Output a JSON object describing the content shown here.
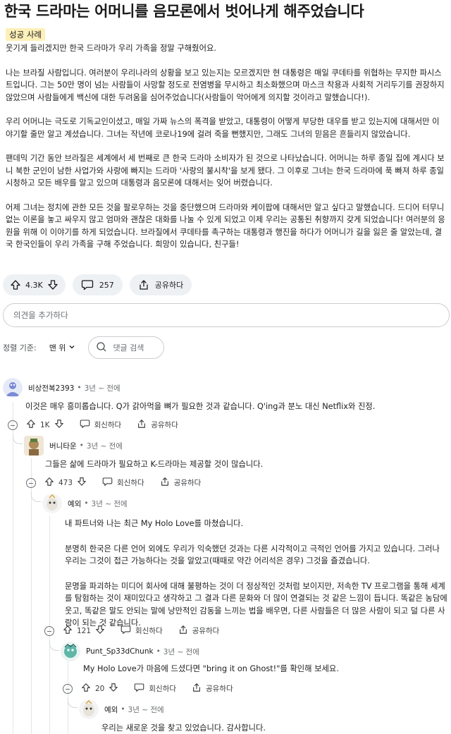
{
  "post": {
    "title": "한국 드라마는 어머니를 음모론에서 벗어나게 해주었습니다",
    "flair": "성공 사례",
    "paragraphs": [
      "웃기게 들리겠지만 한국 드라마가 우리 가족을 정말 구해줬어요.",
      "나는 브라질 사람입니다. 여러분이 우리나라의 상황을 보고 있는지는 모르겠지만 현 대통령은 매일 쿠데타를 위협하는 무지한 파시스트입니다. 그는 50만 명이 넘는 사람들이 사망할 정도로 전염병을 무시하고 최소화했으며 마스크 착용과 사회적 거리두기를 권장하지 않았으며 사람들에게 백신에 대한 두려움을 심어주었습니다(사람들이 악어에게 의지할 것이라고 말했습니다!).",
      "우리 어머니는 극도로 기독교인이셨고, 매일 가짜 뉴스의 폭격을 받았고, 대통령이 어떻게 부당한 대우를 받고 있는지에 대해서만 이야기할 줄만 알고 계셨습니다. 그녀는 작년에 코로나19에 걸려 죽을 뻔했지만, 그래도 그녀의 믿음은 흔들리지 않았습니다.",
      "팬데믹 기간 동안 브라질은 세계에서 세 번째로 큰 한국 드라마 소비자가 된 것으로 나타났습니다. 어머니는 하루 종일 집에 계시다 보니 북한 군인이 남한 사업가와 사랑에 빠지는 드라마 '사랑의 불시착'을 보게 됐다. 그 이후로 그녀는 한국 드라마에 푹 빠져 하루 종일 시청하고 모든 배우를 알고 있으며 대통령과 음모론에 대해서는 잊어 버렸습니다.",
      "어제 그녀는 정치에 관한 모든 것을 팔로우하는 것을 중단했으며 드라마와 케이팝에 대해서만 알고 싶다고 말했습니다. 드디어 터무니없는 이론을 놓고 싸우지 않고 엄마와 괜찮은 대화를 나눌 수 있게 되었고 이제 우리는 공통된 취향까지 갖게 되었습니다! 여러분의 응원을 위해 이 이야기를 하게 되었습니다. 브라질에서 쿠데타를 촉구하는 대통령과 행진을 하다가 어머니가 길을 잃은 줄 알았는데, 결국 한국인들이 우리 가족을 구해 주었습니다. 희망이 있습니다, 친구들!"
    ],
    "votes": "4.3K",
    "comment_count": "257",
    "share_label": "공유하다"
  },
  "comment_input": {
    "placeholder": "의견을 추가하다"
  },
  "sort": {
    "label": "정렬 기준:",
    "value": "맨 위",
    "search_placeholder": "댓글 검색"
  },
  "comments": [
    {
      "author": "비상전복2393",
      "time": "3년 ~ 전에",
      "paragraphs": [
        "이것은 매우 흥미롭습니다. Q가 갉아먹을 뼈가 필요한 것과 같습니다. Q'ing과 분노 대신 Netflix와 진정."
      ],
      "votes": "1K",
      "reply_label": "회신하다",
      "share_label": "공유하다"
    },
    {
      "author": "버니타운",
      "time": "3년 ~ 전에",
      "paragraphs": [
        "그들은 삶에 드라마가 필요하고 K-드라마는 제공할 것이 많습니다."
      ],
      "votes": "473",
      "reply_label": "회신하다",
      "share_label": "공유하다"
    },
    {
      "author": "예외",
      "time": "3년 ~ 전에",
      "paragraphs": [
        "내 파트너와 나는 최근 My Holo Love를 마쳤습니다.",
        "분명히 한국은 다른 언어 외에도 우리가 익숙했던 것과는 다른 시각적이고 극적인 언어를 가지고 있습니다. 그러나 우리는 그것이 접근 가능하다는 것을 알았고(때때로 약간 어리석은 경우) 그것을 즐겼습니다.",
        "문명을 파괴하는 미디어 회사에 대해 불평하는 것이 더 정상적인 것처럼 보이지만, 저속한 TV 프로그램을 통해 세계를 탐험하는 것이 재미있다고 생각하고 그 결과 다른 문화와 더 많이 연결되는 것 같은 느낌이 듭니다. 똑같은 농담에 웃고, 똑같은 말도 안되는 말에 낭만적인 감동을 느끼는 법을 배우면, 다른 사람들은 더 많은 사람이 되고 덜 다른 사람이 되는 것 같습니다."
      ],
      "votes": "121",
      "reply_label": "회신하다",
      "share_label": "공유하다"
    },
    {
      "author": "Punt_Sp33dChunk",
      "time": "3년 ~ 전에",
      "paragraphs": [
        "My Holo Love가 마음에 드셨다면 \"bring it on Ghost!\"를 확인해 보세요."
      ],
      "votes": "20",
      "reply_label": "회신하다",
      "share_label": "공유하다"
    },
    {
      "author": "예외",
      "time": "3년 ~ 전에",
      "paragraphs": [
        "우리는 새로운 것을 찾고 있었습니다. 감사합니다."
      ]
    }
  ],
  "colors": {
    "flair_bg": "#fdf0b8",
    "pill_bg": "#eef1f3",
    "text": "#1a1a1b",
    "meta": "#6a6e71"
  }
}
